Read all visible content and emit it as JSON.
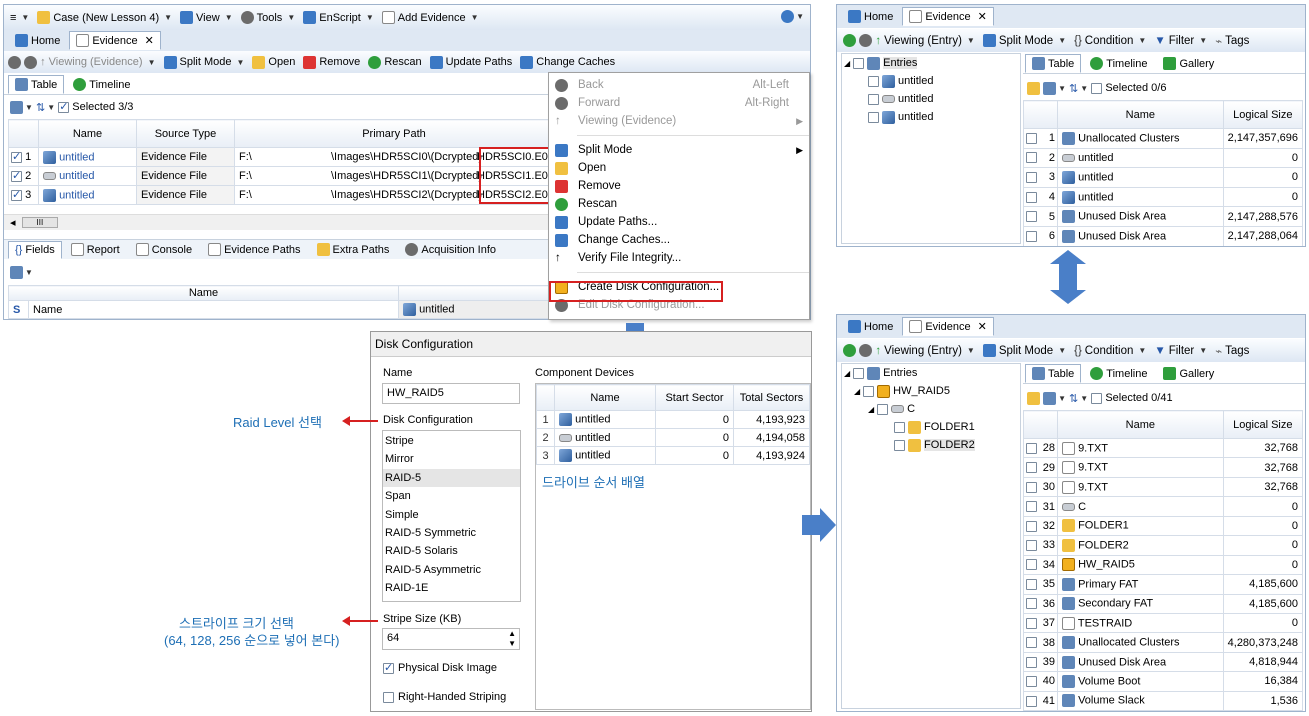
{
  "top_left": {
    "title_bar": {
      "app_menu": "≡",
      "case": "Case (New Lesson 4)",
      "view": "View",
      "tools": "Tools",
      "enscript": "EnScript",
      "add_evidence": "Add Evidence"
    },
    "tabs": [
      "Home",
      "Evidence"
    ],
    "toolbar": {
      "viewing": "Viewing (Evidence)",
      "split_mode": "Split Mode",
      "open": "Open",
      "remove": "Remove",
      "rescan": "Rescan",
      "update_paths": "Update Paths",
      "change_caches": "Change Caches"
    },
    "view_tabs": [
      "Table",
      "Timeline"
    ],
    "selected": "Selected 3/3",
    "columns": [
      "Name",
      "Source Type",
      "Primary Path"
    ],
    "rows": [
      {
        "n": "1",
        "name": "untitled",
        "type": "Evidence File",
        "drive": "F:\\",
        "path": "\\Images\\HDR5SCI0\\(Dcrypted)",
        "file": "HDR5SCI0.E01"
      },
      {
        "n": "2",
        "name": "untitled",
        "type": "Evidence File",
        "drive": "F:\\",
        "path": "\\Images\\HDR5SCI1\\(Dcrypted)",
        "file": "HDR5SCI1.E01"
      },
      {
        "n": "3",
        "name": "untitled",
        "type": "Evidence File",
        "drive": "F:\\",
        "path": "\\Images\\HDR5SCI2\\(Dcrypted)",
        "file": "HDR5SCI2.E01"
      }
    ],
    "scroll_thumb": "III",
    "bottom_tabs": [
      "Fields",
      "Report",
      "Console",
      "Evidence Paths",
      "Extra Paths",
      "Acquisition Info"
    ],
    "field_header": "Name",
    "field_row": {
      "key": "S",
      "name": "Name",
      "value": "untitled"
    }
  },
  "context_menu": {
    "items": [
      {
        "label": "Back",
        "shortcut": "Alt-Left",
        "disabled": true
      },
      {
        "label": "Forward",
        "shortcut": "Alt-Right",
        "disabled": true
      },
      {
        "label": "Viewing (Evidence)",
        "shortcut": "",
        "disabled": true
      },
      {
        "label": "Split Mode",
        "shortcut": ""
      },
      {
        "label": "Open",
        "shortcut": ""
      },
      {
        "label": "Remove",
        "shortcut": ""
      },
      {
        "label": "Rescan",
        "shortcut": ""
      },
      {
        "label": "Update Paths...",
        "shortcut": ""
      },
      {
        "label": "Change Caches...",
        "shortcut": ""
      },
      {
        "label": "Verify File Integrity...",
        "shortcut": ""
      },
      {
        "label": "Create Disk Configuration...",
        "shortcut": ""
      },
      {
        "label": "Edit Disk Configuration...",
        "shortcut": "",
        "disabled": true
      }
    ]
  },
  "disk_config": {
    "title": "Disk Configuration",
    "name_label": "Name",
    "name_value": "HW_RAID5",
    "config_label": "Disk Configuration",
    "options": [
      "Stripe",
      "Mirror",
      "RAID-5",
      "Span",
      "Simple",
      "RAID-5 Symmetric",
      "RAID-5 Solaris",
      "RAID-5 Asymmetric",
      "RAID-1E"
    ],
    "selected_option": "RAID-5",
    "stripe_label": "Stripe Size (KB)",
    "stripe_value": "64",
    "physical_disk": "Physical Disk Image",
    "right_handed": "Right-Handed Striping",
    "component_label": "Component Devices",
    "comp_columns": [
      "Name",
      "Start Sector",
      "Total Sectors"
    ],
    "comp_rows": [
      {
        "n": "1",
        "name": "untitled",
        "start": "0",
        "total": "4,193,923"
      },
      {
        "n": "2",
        "name": "untitled",
        "start": "0",
        "total": "4,194,058"
      },
      {
        "n": "3",
        "name": "untitled",
        "start": "0",
        "total": "4,193,924"
      }
    ]
  },
  "notes": {
    "raid_level": "Raid Level 선택",
    "stripe_size": "스트라이프 크기 선택",
    "stripe_order": "(64, 128, 256 순으로 넣어 본다)",
    "drive_order": "드라이브 순서 배열"
  },
  "top_right": {
    "tabs": [
      "Home",
      "Evidence"
    ],
    "toolbar": {
      "viewing": "Viewing (Entry)",
      "split_mode": "Split Mode",
      "condition": "Condition",
      "filter": "Filter",
      "tags": "Tags"
    },
    "tree_root": "Entries",
    "tree_items": [
      "untitled",
      "untitled",
      "untitled"
    ],
    "view_tabs": [
      "Table",
      "Timeline",
      "Gallery"
    ],
    "selected": "Selected 0/6",
    "columns": [
      "Name",
      "Logical Size"
    ],
    "rows": [
      {
        "n": "1",
        "name": "Unallocated Clusters",
        "size": "2,147,357,696",
        "icon": "grid"
      },
      {
        "n": "2",
        "name": "untitled",
        "size": "0",
        "icon": "disk"
      },
      {
        "n": "3",
        "name": "untitled",
        "size": "0",
        "icon": "img"
      },
      {
        "n": "4",
        "name": "untitled",
        "size": "0",
        "icon": "img"
      },
      {
        "n": "5",
        "name": "Unused Disk Area",
        "size": "2,147,288,576",
        "icon": "grid"
      },
      {
        "n": "6",
        "name": "Unused Disk Area",
        "size": "2,147,288,064",
        "icon": "grid"
      }
    ]
  },
  "bottom_right": {
    "tabs": [
      "Home",
      "Evidence"
    ],
    "toolbar": {
      "viewing": "Viewing (Entry)",
      "split_mode": "Split Mode",
      "condition": "Condition",
      "filter": "Filter",
      "tags": "Tags"
    },
    "tree": [
      "Entries",
      "HW_RAID5",
      "C",
      "FOLDER1",
      "FOLDER2"
    ],
    "view_tabs": [
      "Table",
      "Timeline",
      "Gallery"
    ],
    "selected": "Selected 0/41",
    "columns": [
      "Name",
      "Logical Size"
    ],
    "rows": [
      {
        "n": "28",
        "name": "9.TXT",
        "size": "32,768",
        "icon": "doc"
      },
      {
        "n": "29",
        "name": "9.TXT",
        "size": "32,768",
        "icon": "doc"
      },
      {
        "n": "30",
        "name": "9.TXT",
        "size": "32,768",
        "icon": "doc"
      },
      {
        "n": "31",
        "name": "C",
        "size": "0",
        "icon": "disk"
      },
      {
        "n": "32",
        "name": "FOLDER1",
        "size": "0",
        "icon": "folder"
      },
      {
        "n": "33",
        "name": "FOLDER2",
        "size": "0",
        "icon": "folder"
      },
      {
        "n": "34",
        "name": "HW_RAID5",
        "size": "0",
        "icon": "raid"
      },
      {
        "n": "35",
        "name": "Primary FAT",
        "size": "4,185,600",
        "icon": "grid"
      },
      {
        "n": "36",
        "name": "Secondary FAT",
        "size": "4,185,600",
        "icon": "grid"
      },
      {
        "n": "37",
        "name": "TESTRAID",
        "size": "0",
        "icon": "doc"
      },
      {
        "n": "38",
        "name": "Unallocated Clusters",
        "size": "4,280,373,248",
        "icon": "grid"
      },
      {
        "n": "39",
        "name": "Unused Disk Area",
        "size": "4,818,944",
        "icon": "grid"
      },
      {
        "n": "40",
        "name": "Volume Boot",
        "size": "16,384",
        "icon": "grid"
      },
      {
        "n": "41",
        "name": "Volume Slack",
        "size": "1,536",
        "icon": "grid"
      }
    ]
  },
  "colors": {
    "accent": "#4a7fc8",
    "highlight_box": "#d62020",
    "note": "#1e6fb5"
  }
}
